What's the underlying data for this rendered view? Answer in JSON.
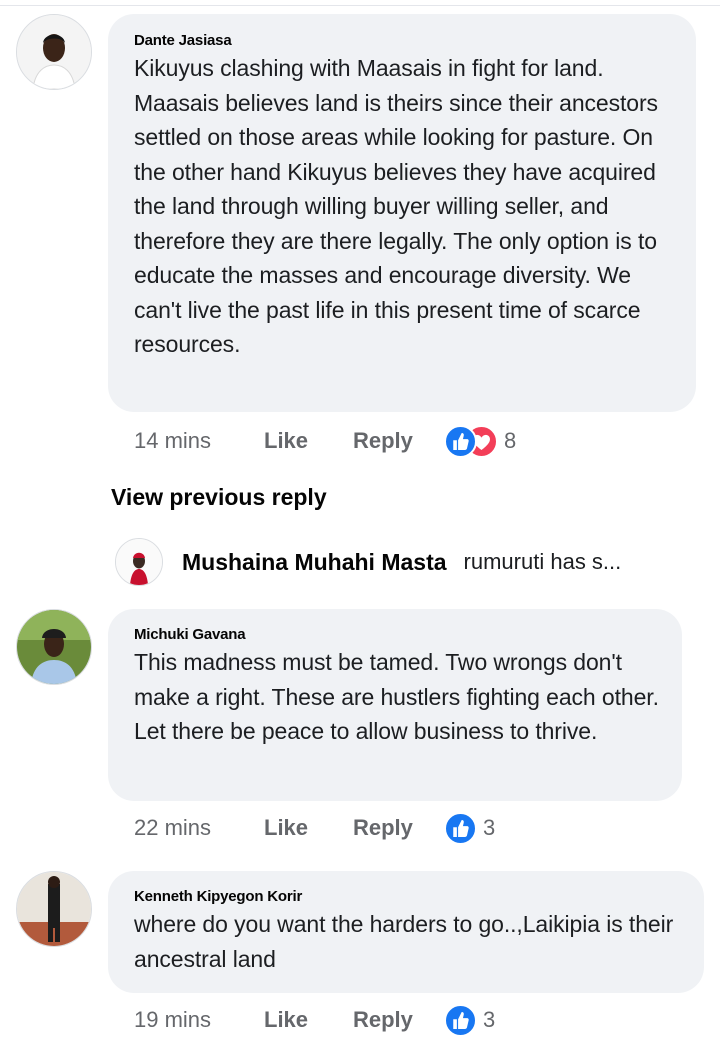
{
  "comments": [
    {
      "author": "Dante Jasiasa",
      "text": "Kikuyus clashing with Maasais in fight for land. Maasais believes land is theirs since their ancestors settled on those areas while looking for pasture. On the other hand Kikuyus believes they have acquired the land through willing buyer willing seller, and therefore they are there legally. The only option is to educate the masses and encourage diversity. We can't live the past life in this present time of scarce resources.",
      "time": "14 mins",
      "like_label": "Like",
      "reply_label": "Reply",
      "reaction_icons": [
        "like-icon",
        "love-icon"
      ],
      "reaction_count": "8"
    },
    {
      "author": "Michuki Gavana",
      "text": "This madness must be tamed. Two wrongs don't make a right. These are hustlers fighting each other. Let there be peace to allow business to thrive.",
      "time": "22 mins",
      "like_label": "Like",
      "reply_label": "Reply",
      "reaction_icons": [
        "like-icon"
      ],
      "reaction_count": "3"
    },
    {
      "author": "Kenneth Kipyegon Korir",
      "text": "where do you want the harders to go..,Laikipia is their ancestral land",
      "time": "19 mins",
      "like_label": "Like",
      "reply_label": "Reply",
      "reaction_icons": [
        "like-icon"
      ],
      "reaction_count": "3"
    }
  ],
  "thread": {
    "view_previous_label": "View previous reply",
    "reply_author": "Mushaina Muhahi Masta",
    "reply_snippet": "rumuruti has s..."
  },
  "colors": {
    "bubble": "#f0f2f5",
    "like_blue": "#1877f2",
    "love_red": "#f33e58",
    "meta_gray": "#65676b"
  }
}
